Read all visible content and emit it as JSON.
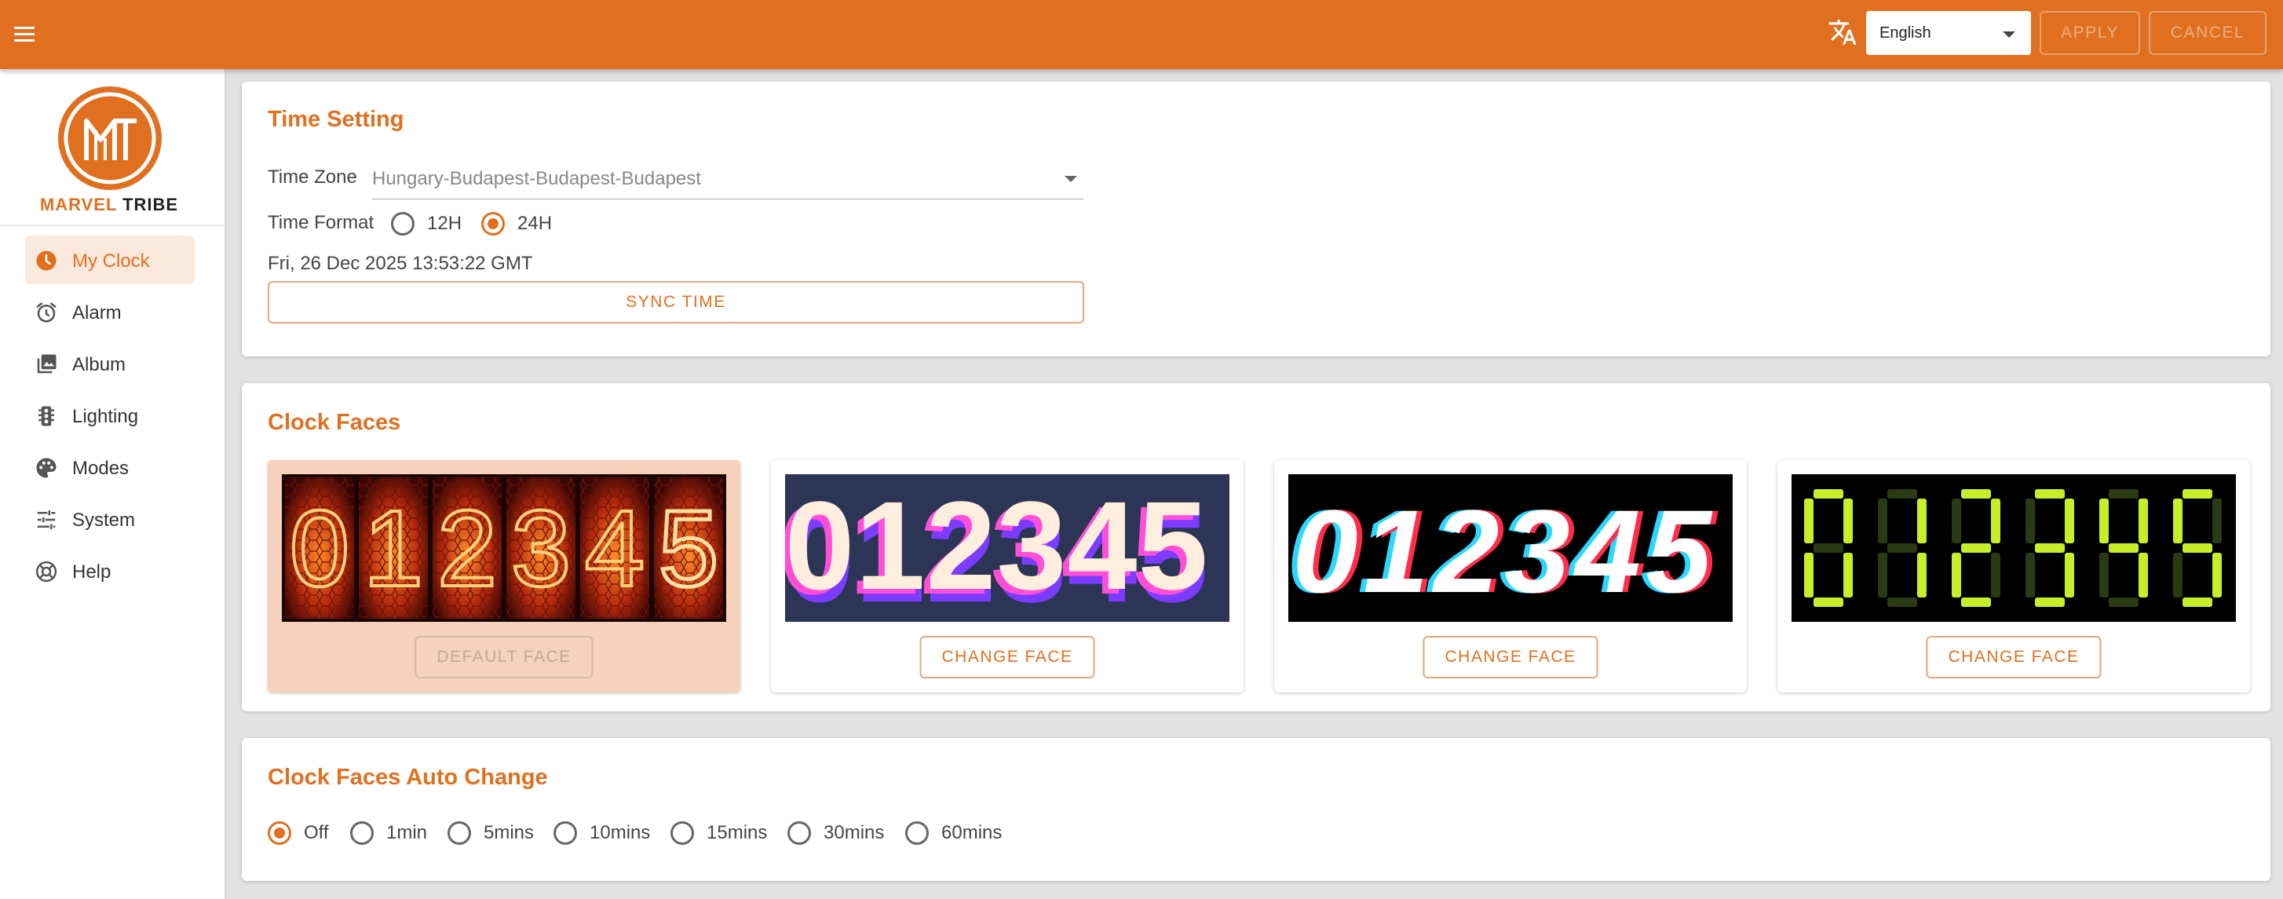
{
  "header": {
    "language": "English",
    "apply_label": "APPLY",
    "cancel_label": "CANCEL",
    "accent_color": "#e07020",
    "icons": [
      "menu-icon",
      "translate-icon",
      "chevron-down-icon"
    ]
  },
  "sidebar": {
    "brand_part1": "MARVEL",
    "brand_part2": "TRIBE",
    "items": [
      {
        "label": "My Clock",
        "icon": "clock-icon",
        "active": true
      },
      {
        "label": "Alarm",
        "icon": "alarm-icon"
      },
      {
        "label": "Album",
        "icon": "photo-library-icon"
      },
      {
        "label": "Lighting",
        "icon": "traffic-light-icon"
      },
      {
        "label": "Modes",
        "icon": "palette-icon"
      },
      {
        "label": "System",
        "icon": "tune-icon"
      },
      {
        "label": "Help",
        "icon": "help-lifebuoy-icon"
      }
    ]
  },
  "time_setting": {
    "title": "Time Setting",
    "timezone_label": "Time Zone",
    "timezone_value": "Hungary-Budapest-Budapest-Budapest",
    "format_label": "Time Format",
    "format_options": [
      "12H",
      "24H"
    ],
    "format_selected": "24H",
    "current_time": "Fri, 26 Dec 2025 13:53:22 GMT",
    "sync_label": "SYNC TIME"
  },
  "clock_faces": {
    "title": "Clock Faces",
    "digits": "012345",
    "faces": [
      {
        "style": "nixie-tube",
        "button": "DEFAULT FACE",
        "selected": true
      },
      {
        "style": "3d-pink-purple",
        "button": "CHANGE FACE"
      },
      {
        "style": "glitch-chromatic",
        "button": "CHANGE FACE"
      },
      {
        "style": "seven-segment-green",
        "button": "CHANGE FACE"
      }
    ]
  },
  "auto_change": {
    "title": "Clock Faces Auto Change",
    "options": [
      "Off",
      "1min",
      "5mins",
      "10mins",
      "15mins",
      "30mins",
      "60mins"
    ],
    "selected": "Off"
  }
}
